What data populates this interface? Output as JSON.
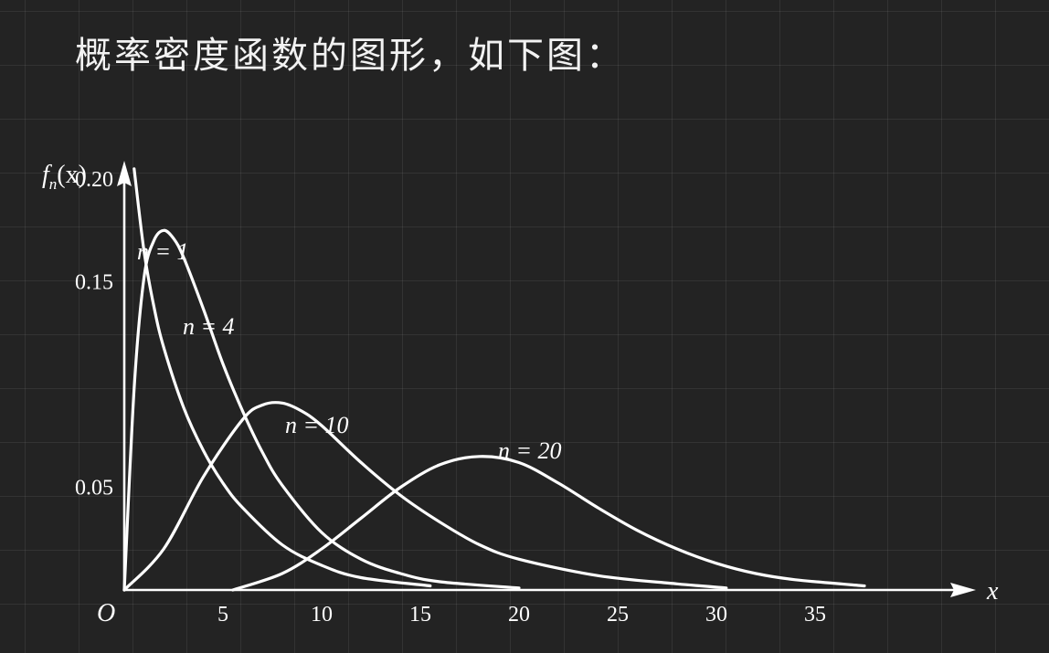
{
  "slide": {
    "title": "概率密度函数的图形，如下图："
  },
  "chart_data": {
    "type": "line",
    "xlabel": "x",
    "ylabel": "f_n(x)",
    "ylabel_main": "f",
    "ylabel_sub": "n",
    "ylabel_paren": "(x)",
    "origin_label": "O",
    "xlim": [
      0,
      42
    ],
    "ylim": [
      0,
      0.22
    ],
    "x_ticks": [
      5,
      10,
      15,
      20,
      25,
      30,
      35
    ],
    "x_tick_labels": [
      "5",
      "10",
      "15",
      "20",
      "25",
      "30",
      "35"
    ],
    "y_ticks": [
      0.05,
      0.15,
      0.2
    ],
    "y_tick_labels": [
      "0.05",
      "0.15",
      "0.20"
    ],
    "grid": false,
    "series": [
      {
        "name": "n = 1",
        "x": [
          0.5,
          1,
          1.5,
          2,
          3,
          4,
          5,
          6,
          8,
          10,
          12,
          15.5
        ],
        "y": [
          0.205,
          0.165,
          0.138,
          0.118,
          0.089,
          0.068,
          0.052,
          0.04,
          0.022,
          0.012,
          0.006,
          0.002
        ]
      },
      {
        "name": "n = 4",
        "x": [
          0,
          0.5,
          1,
          1.5,
          2,
          2.5,
          3,
          4,
          5,
          6,
          7,
          8,
          10,
          12,
          14,
          16,
          20
        ],
        "y": [
          0.0,
          0.098,
          0.152,
          0.17,
          0.175,
          0.171,
          0.162,
          0.137,
          0.11,
          0.087,
          0.067,
          0.051,
          0.028,
          0.015,
          0.008,
          0.004,
          0.001
        ]
      },
      {
        "name": "n = 10",
        "x": [
          0,
          2,
          4,
          6,
          7,
          8,
          9,
          10,
          12,
          14,
          16,
          18,
          20,
          24,
          28,
          30.5
        ],
        "y": [
          0.0,
          0.02,
          0.055,
          0.083,
          0.09,
          0.091,
          0.087,
          0.08,
          0.062,
          0.046,
          0.033,
          0.022,
          0.015,
          0.007,
          0.003,
          0.001
        ]
      },
      {
        "name": "n = 20",
        "x": [
          5.5,
          8,
          10,
          12,
          14,
          16,
          18,
          20,
          22,
          24,
          26,
          28,
          30,
          32,
          34,
          37.5
        ],
        "y": [
          0.0,
          0.008,
          0.02,
          0.035,
          0.05,
          0.061,
          0.065,
          0.062,
          0.052,
          0.04,
          0.029,
          0.02,
          0.013,
          0.008,
          0.005,
          0.002
        ]
      }
    ]
  }
}
